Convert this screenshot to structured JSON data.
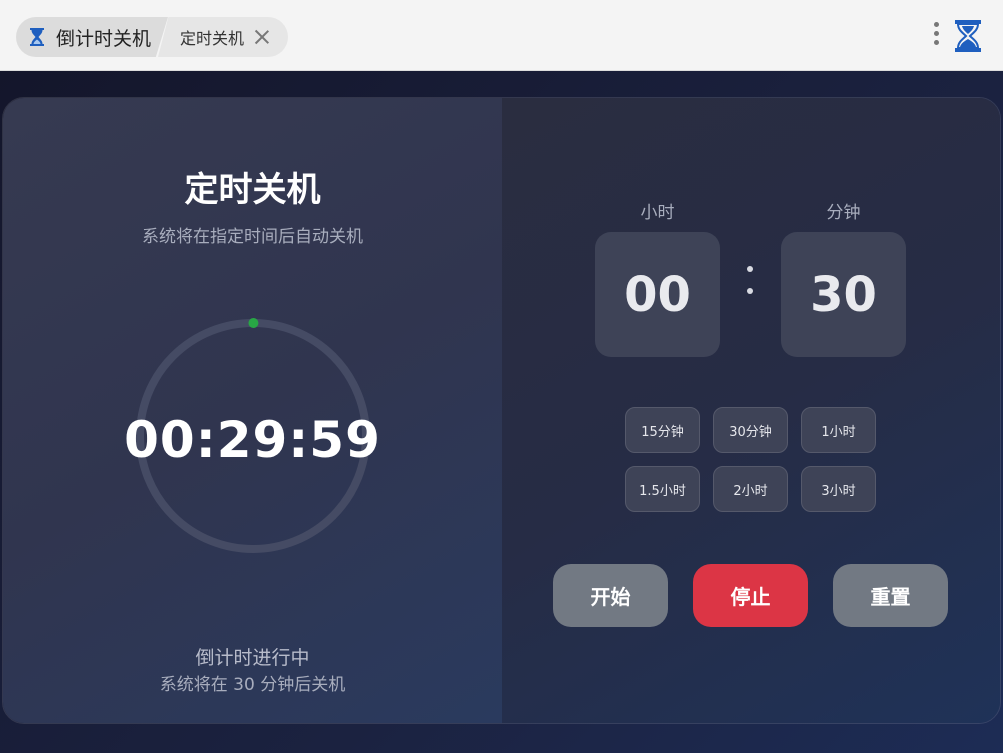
{
  "window": {
    "app_tab_label": "倒计时关机",
    "page_tab_label": "定时关机",
    "app_icon": "hourglass-icon",
    "menu_icon": "kebab-menu-icon",
    "logo_icon": "hourglass-logo-icon"
  },
  "main": {
    "title": "定时关机",
    "subtitle": "系统将在指定时间后自动关机",
    "countdown": "00:29:59",
    "progress_remaining": 0.9994,
    "status": "倒计时进行中",
    "status_detail": "系统将在 30 分钟后关机"
  },
  "time_input": {
    "hours_label": "小时",
    "hours_value": "00",
    "minutes_label": "分钟",
    "minutes_value": "30"
  },
  "presets": [
    "15分钟",
    "30分钟",
    "1小时",
    "1.5小时",
    "2小时",
    "3小时"
  ],
  "actions": {
    "start": "开始",
    "stop": "停止",
    "reset": "重置"
  },
  "colors": {
    "accent_red": "#dc3545",
    "progress_green": "#28a745",
    "button_gray": "#727983"
  }
}
